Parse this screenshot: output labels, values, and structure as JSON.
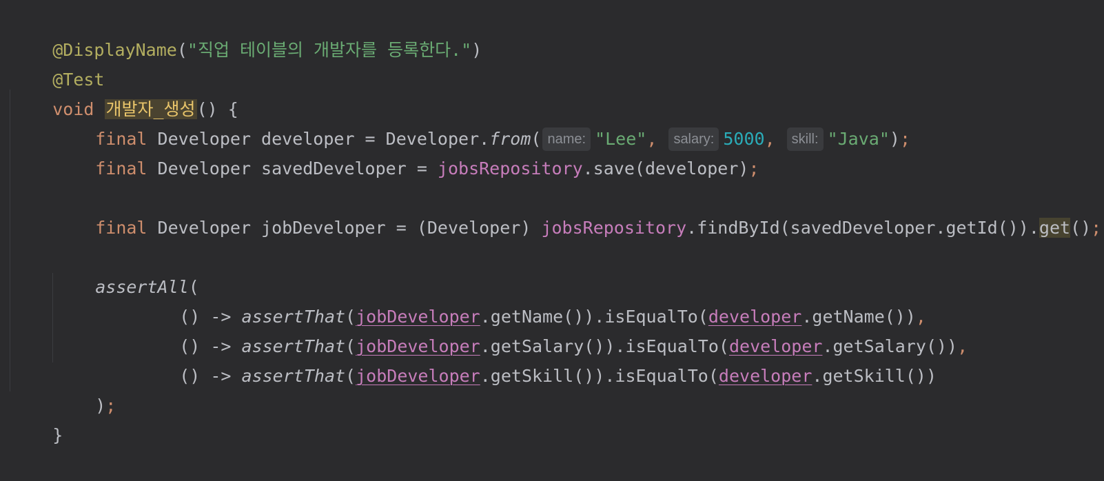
{
  "code": {
    "l1": {
      "anno": "@DisplayName",
      "open": "(",
      "str": "\"직업 테이블의 개발자를 등록한다.\"",
      "close": ")"
    },
    "l2": {
      "anno": "@Test"
    },
    "l3": {
      "kw": "void",
      "method": "개발자_생성",
      "rest": "() {"
    },
    "l4": {
      "kw": "final",
      "a": " Developer developer = Developer.",
      "fn": "from",
      "open": "(",
      "hint1": "name:",
      "s1": "\"Lee\"",
      "comma1": ", ",
      "hint2": "salary:",
      "n1": "5000",
      "comma2": ", ",
      "hint3": "skill:",
      "s2": "\"Java\"",
      "close": ")",
      "semi": ";"
    },
    "l5": {
      "kw": "final",
      "a": " Developer savedDeveloper = ",
      "field": "jobsRepository",
      "b": ".save(developer)",
      "semi": ";"
    },
    "l7": {
      "kw": "final",
      "a": " Developer jobDeveloper = (Developer) ",
      "field": "jobsRepository",
      "b": ".findById(savedDeveloper.getId()).",
      "get": "get",
      "c": "()",
      "semi": ";"
    },
    "l9": {
      "fn": "assertAll",
      "open": "("
    },
    "l10": {
      "a": "() -> ",
      "fn": "assertThat",
      "open": "(",
      "f1": "jobDeveloper",
      "b": ".getName()).isEqualTo(",
      "f2": "developer",
      "c": ".getName())",
      "comma": ","
    },
    "l11": {
      "a": "() -> ",
      "fn": "assertThat",
      "open": "(",
      "f1": "jobDeveloper",
      "b": ".getSalary()).isEqualTo(",
      "f2": "developer",
      "c": ".getSalary())",
      "comma": ","
    },
    "l12": {
      "a": "() -> ",
      "fn": "assertThat",
      "open": "(",
      "f1": "jobDeveloper",
      "b": ".getSkill()).isEqualTo(",
      "f2": "developer",
      "c": ".getSkill())"
    },
    "l13": {
      "a": ")",
      "semi": ";"
    },
    "l14": {
      "a": "}"
    }
  },
  "colors": {
    "background": "#2b2b2d",
    "annotation": "#b3ae60",
    "string": "#6aab73",
    "keyword": "#cf8e6d",
    "number": "#2aacb8",
    "field": "#c77dbb",
    "text": "#bcbec4"
  }
}
